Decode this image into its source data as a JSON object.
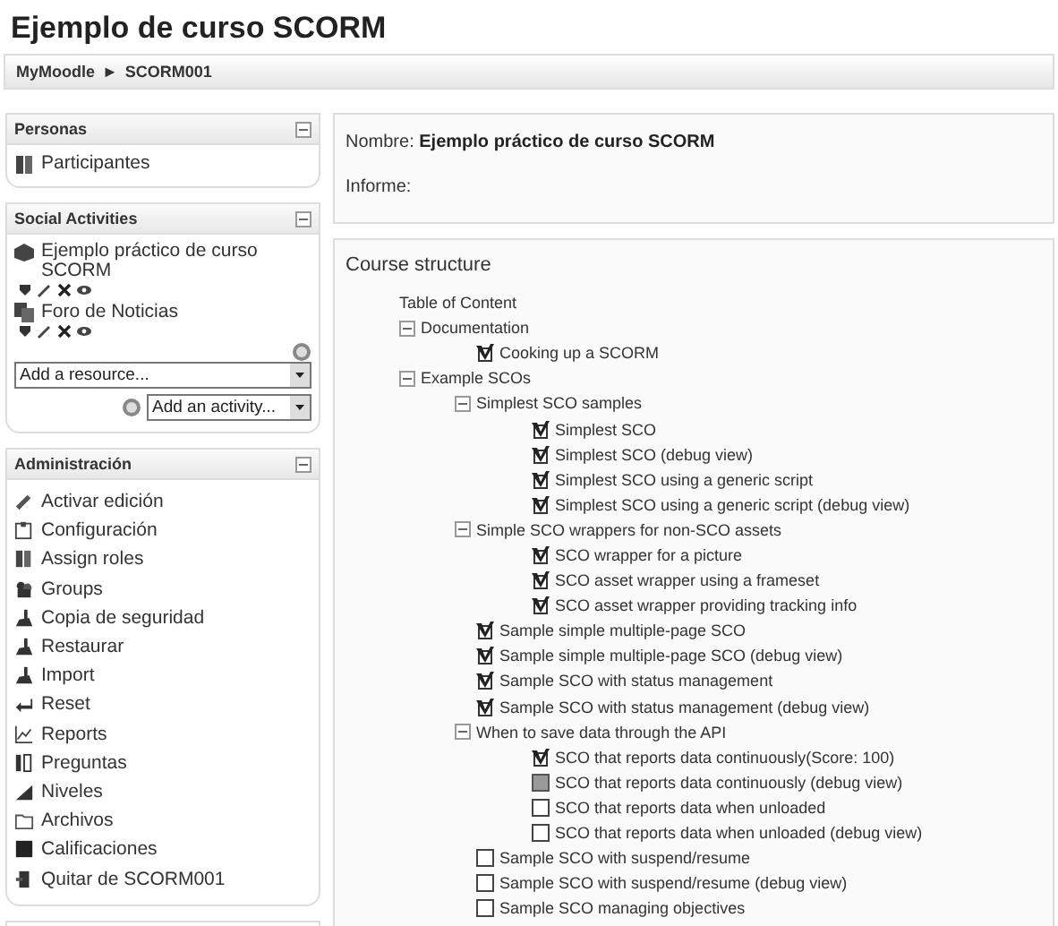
{
  "page_title": "Ejemplo de curso SCORM",
  "breadcrumb": {
    "items": [
      "MyMoodle",
      "SCORM001"
    ],
    "separator": "►"
  },
  "personas": {
    "title": "Personas",
    "items": [
      "Participantes"
    ]
  },
  "social": {
    "title": "Social Activities",
    "activities": [
      "Ejemplo práctico de curso SCORM",
      "Foro de Noticias"
    ],
    "resource_select": {
      "value": "Add a resource..."
    },
    "activity_select": {
      "value": "Add an activity..."
    }
  },
  "admin": {
    "title": "Administración",
    "items": [
      "Activar edición",
      "Configuración",
      "Assign roles",
      "Groups",
      "Copia de seguridad",
      "Restaurar",
      "Import",
      "Reset",
      "Reports",
      "Preguntas",
      "Niveles",
      "Archivos",
      "Calificaciones",
      "Quitar de SCORM001"
    ]
  },
  "info": {
    "name_label": "Nombre:",
    "name_value": "Ejemplo práctico de curso SCORM",
    "report_label": "Informe:"
  },
  "structure": {
    "title": "Course structure",
    "toc_title": "Table of Content",
    "tree": [
      {
        "kind": "section",
        "label": "Documentation",
        "expanded": true,
        "children": [
          {
            "kind": "completed",
            "label": "Cooking up a SCORM"
          }
        ]
      },
      {
        "kind": "section",
        "label": "Example SCOs",
        "expanded": true,
        "children": [
          {
            "kind": "section",
            "label": "Simplest SCO samples",
            "expanded": true,
            "children": [
              {
                "kind": "completed",
                "label": "Simplest SCO"
              },
              {
                "kind": "completed",
                "label": "Simplest SCO (debug view)"
              },
              {
                "kind": "completed",
                "label": "Simplest SCO using a generic script"
              },
              {
                "kind": "completed",
                "label": "Simplest SCO using a generic script (debug view)"
              }
            ]
          },
          {
            "kind": "section",
            "label": "Simple SCO wrappers for non-SCO assets",
            "expanded": true,
            "children": [
              {
                "kind": "completed",
                "label": "SCO wrapper for a picture"
              },
              {
                "kind": "completed",
                "label": "SCO asset wrapper using a frameset"
              },
              {
                "kind": "completed",
                "label": "SCO asset wrapper providing tracking info"
              }
            ]
          },
          {
            "kind": "completed",
            "label": "Sample simple multiple-page SCO"
          },
          {
            "kind": "completed",
            "label": "Sample simple multiple-page SCO (debug view)"
          },
          {
            "kind": "completed",
            "label": "Sample SCO with status management"
          },
          {
            "kind": "completed",
            "label": "Sample SCO with status management (debug view)"
          },
          {
            "kind": "section",
            "label": "When to save data through the API",
            "expanded": true,
            "children": [
              {
                "kind": "completed",
                "label": "SCO that reports data continuously(Score: 100)"
              },
              {
                "kind": "browsed",
                "label": "SCO that reports data continuously (debug view)"
              },
              {
                "kind": "notattempted",
                "label": "SCO that reports data when unloaded"
              },
              {
                "kind": "notattempted",
                "label": "SCO that reports data when unloaded (debug view)"
              }
            ]
          },
          {
            "kind": "notattempted",
            "label": "Sample SCO with suspend/resume"
          },
          {
            "kind": "notattempted",
            "label": "Sample SCO with suspend/resume (debug view)"
          },
          {
            "kind": "notattempted",
            "label": "Sample SCO managing objectives"
          }
        ]
      }
    ]
  }
}
